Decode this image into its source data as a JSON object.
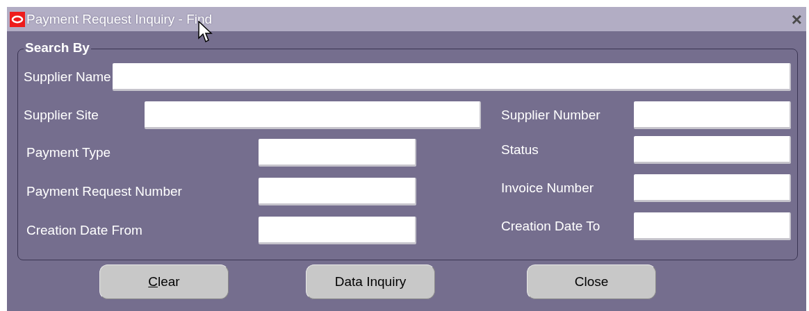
{
  "window": {
    "title": "Payment Request Inquiry - Find",
    "close": "×"
  },
  "search_by": {
    "title": "Search By",
    "supplier_name": {
      "label": "Supplier Name"
    },
    "left_fields": [
      {
        "label": "Supplier Site",
        "kind": "wide"
      },
      {
        "label": "Payment Type",
        "kind": "short"
      },
      {
        "label": "Payment Request Number",
        "kind": "short"
      },
      {
        "label": "Creation Date From",
        "kind": "short"
      }
    ],
    "right_fields": [
      {
        "label": "Supplier Number"
      },
      {
        "label": "Status"
      },
      {
        "label": "Invoice Number"
      },
      {
        "label": "Creation Date To"
      }
    ]
  },
  "buttons": [
    {
      "label": "Clear",
      "mnemonic": true
    },
    {
      "label": "Data Inquiry",
      "mnemonic": false
    },
    {
      "label": "Close",
      "mnemonic": false
    }
  ]
}
